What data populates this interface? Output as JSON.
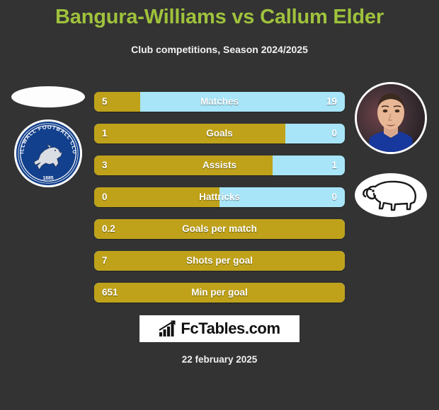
{
  "header": {
    "title": "Bangura-Williams vs Callum Elder",
    "subtitle": "Club competitions, Season 2024/2025",
    "title_color": "#9fc23c"
  },
  "colors": {
    "background": "#333333",
    "home_bar": "#bfa21a",
    "away_bar": "#a8e5f8",
    "text": "#ffffff"
  },
  "home_player": {
    "name": "Bangura-Williams",
    "photo": "blank-photo-placeholder",
    "club_badge": "millwall-football-club-badge",
    "club_name": "MILLWALL FOOTBALL CLUB",
    "club_year": "1885"
  },
  "away_player": {
    "name": "Callum Elder",
    "photo": "player-photo",
    "club_badge": "derby-county-ram-badge"
  },
  "stats": [
    {
      "label": "Matches",
      "home": "5",
      "away": "19",
      "home_pct": 18.4,
      "dual": true
    },
    {
      "label": "Goals",
      "home": "1",
      "away": "0",
      "home_pct": 76.3,
      "dual": true
    },
    {
      "label": "Assists",
      "home": "3",
      "away": "1",
      "home_pct": 71.2,
      "dual": true
    },
    {
      "label": "Hattricks",
      "home": "0",
      "away": "0",
      "home_pct": 50.0,
      "dual": true
    },
    {
      "label": "Goals per match",
      "home": "0.2",
      "away": "",
      "home_pct": 100,
      "dual": false
    },
    {
      "label": "Shots per goal",
      "home": "7",
      "away": "",
      "home_pct": 100,
      "dual": false
    },
    {
      "label": "Min per goal",
      "home": "651",
      "away": "",
      "home_pct": 100,
      "dual": false
    }
  ],
  "footer": {
    "logo_text": "FcTables.com",
    "logo_icon": "bar-chart-growth-icon",
    "date": "22 february 2025"
  },
  "chart_data": {
    "type": "bar",
    "title": "Bangura-Williams vs Callum Elder",
    "subtitle": "Club competitions, Season 2024/2025",
    "orientation": "horizontal-diverging",
    "categories": [
      "Matches",
      "Goals",
      "Assists",
      "Hattricks",
      "Goals per match",
      "Shots per goal",
      "Min per goal"
    ],
    "series": [
      {
        "name": "Bangura-Williams",
        "color": "#bfa21a",
        "values": [
          5,
          1,
          3,
          0,
          0.2,
          7,
          651
        ]
      },
      {
        "name": "Callum Elder",
        "color": "#a8e5f8",
        "values": [
          19,
          0,
          1,
          0,
          null,
          null,
          null
        ]
      }
    ],
    "grid": false,
    "legend": "none"
  }
}
